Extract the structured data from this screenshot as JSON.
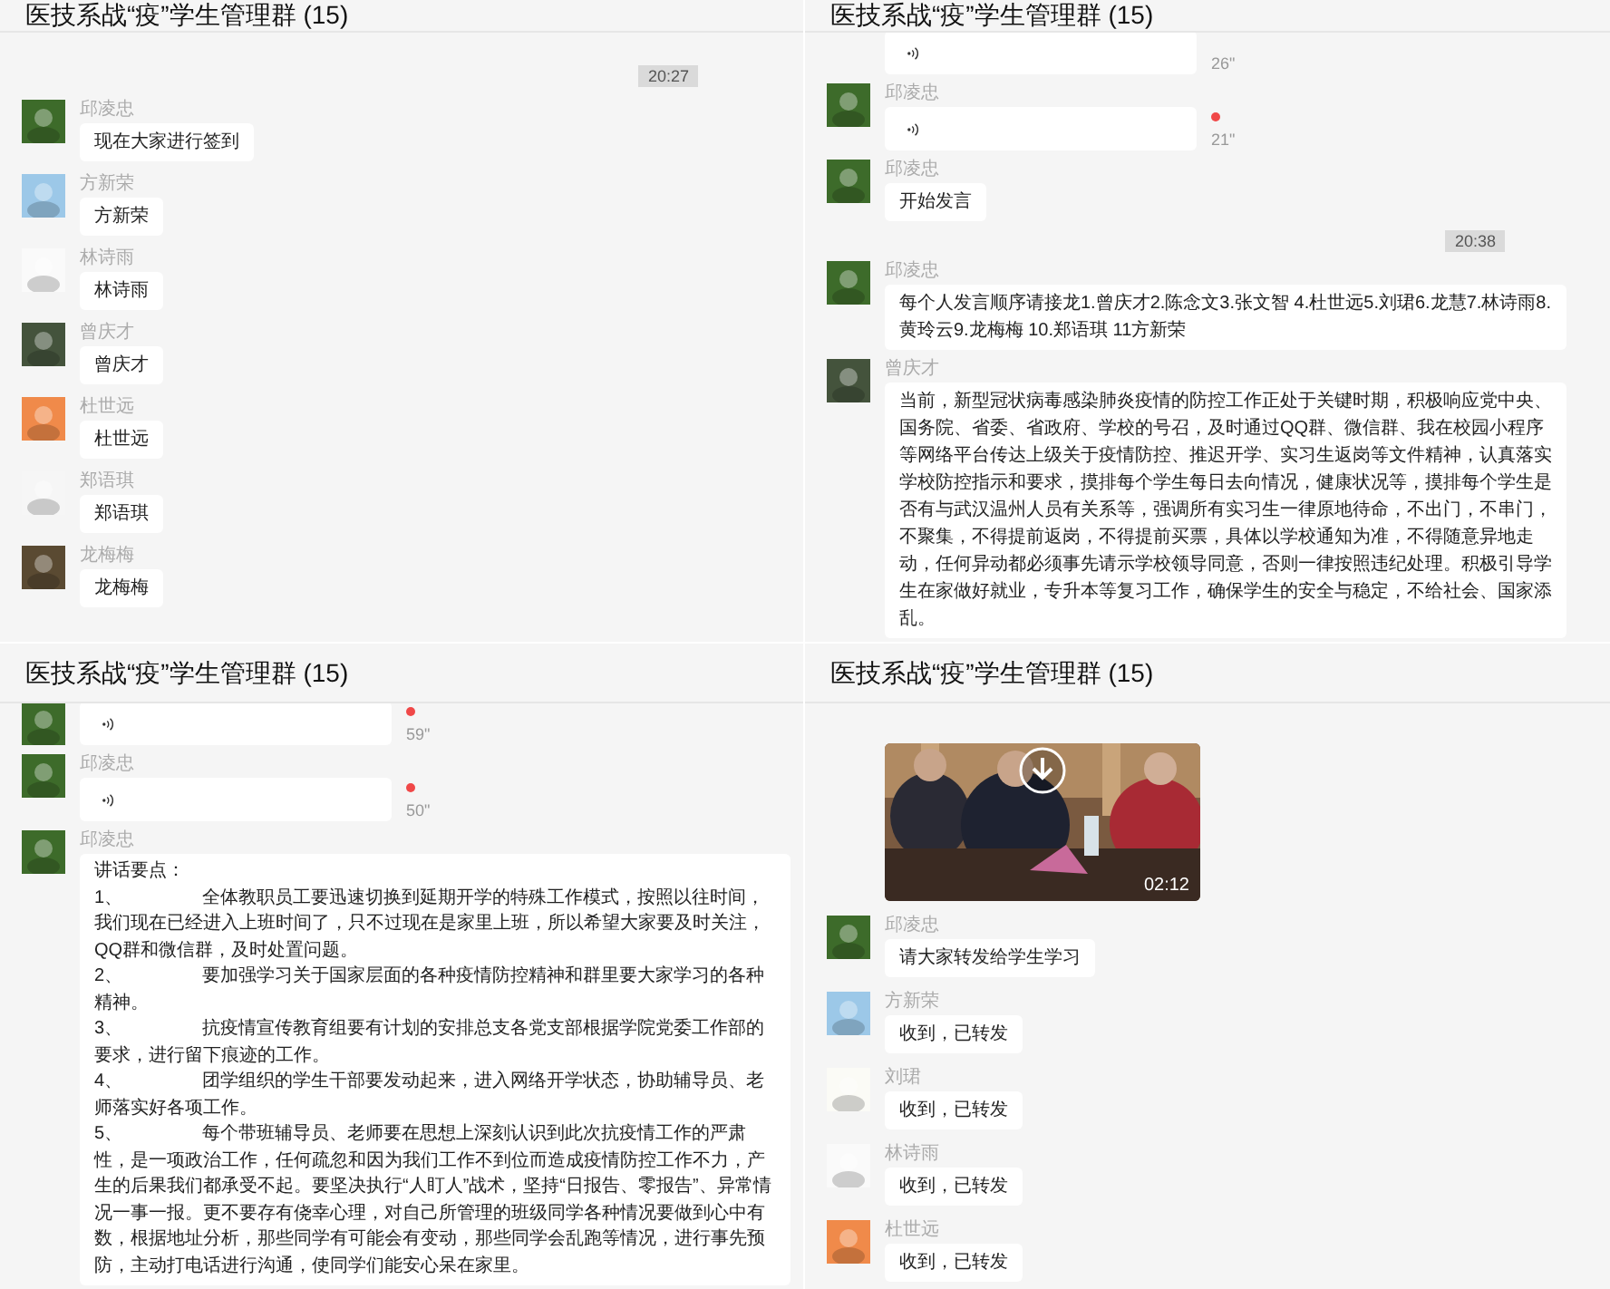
{
  "panels": [
    {
      "title": "医技系战“疫”学生管理群 (15)",
      "messages": [
        {
          "kind": "time",
          "text": "20:27"
        },
        {
          "kind": "text",
          "sender": "邱凌忠",
          "color": "#3d6b2a",
          "text": "现在大家进行签到"
        },
        {
          "kind": "text",
          "sender": "方新荣",
          "color": "#9cc8e8",
          "text": "方新荣"
        },
        {
          "kind": "text",
          "sender": "林诗雨",
          "color": "#fafafa",
          "text": "林诗雨"
        },
        {
          "kind": "text",
          "sender": "曾庆才",
          "color": "#44533c",
          "text": "曾庆才"
        },
        {
          "kind": "text",
          "sender": "杜世远",
          "color": "#f08a4a",
          "text": "杜世远"
        },
        {
          "kind": "text",
          "sender": "郑语琪",
          "color": "#f6f6f6",
          "text": "郑语琪"
        },
        {
          "kind": "text",
          "sender": "龙梅梅",
          "color": "#5a4a32",
          "text": "龙梅梅"
        }
      ]
    },
    {
      "title": "医技系战“疫”学生管理群 (15)",
      "messages": [
        {
          "kind": "voice",
          "duration": "26\""
        },
        {
          "kind": "voice",
          "sender": "邱凌忠",
          "color": "#3d6b2a",
          "duration": "21\"",
          "unread": true
        },
        {
          "kind": "text",
          "sender": "邱凌忠",
          "color": "#3d6b2a",
          "text": "开始发言"
        },
        {
          "kind": "time",
          "text": "20:38"
        },
        {
          "kind": "text",
          "sender": "邱凌忠",
          "color": "#3d6b2a",
          "text": "每个人发言顺序请接龙1.曾庆才2.陈念文3.张文智 4.杜世远5.刘珺6.龙慧7.林诗雨8.黄玲云9.龙梅梅 10.郑语琪 11方新荣"
        },
        {
          "kind": "text",
          "sender": "曾庆才",
          "color": "#44533c",
          "text": "当前，新型冠状病毒感染肺炎疫情的防控工作正处于关键时期，积极响应党中央、国务院、省委、省政府、学校的号召，及时通过QQ群、微信群、我在校园小程序等网络平台传达上级关于疫情防控、推迟开学、实习生返岗等文件精神，认真落实学校防控指示和要求，摸排每个学生每日去向情况，健康状况等，摸排每个学生是否有与武汉温州人员有关系等，强调所有实习生一律原地待命，不出门，不串门，不聚集，不得提前返岗，不得提前买票，具体以学校通知为准，不得随意异地走动，任何异动都必须事先请示学校领导同意，否则一律按照违纪处理。积极引导学生在家做好就业，专升本等复习工作，确保学生的安全与稳定，不给社会、国家添乱。"
        }
      ]
    },
    {
      "title": "医技系战“疫”学生管理群 (15)",
      "messages": [
        {
          "kind": "voice",
          "color": "#3d6b2a",
          "duration": "59\"",
          "unread": true
        },
        {
          "kind": "voice",
          "sender": "邱凌忠",
          "color": "#3d6b2a",
          "duration": "50\"",
          "unread": true
        },
        {
          "kind": "speech",
          "sender": "邱凌忠",
          "color": "#3d6b2a",
          "heading": "讲话要点：",
          "items": [
            {
              "num": "1、",
              "text": "全体教职员工要迅速切换到延期开学的特殊工作模式，按照以往时间，我们现在已经进入上班时间了，只不过现在是家里上班，所以希望大家要及时关注，QQ群和微信群，及时处置问题。"
            },
            {
              "num": "2、",
              "text": "要加强学习关于国家层面的各种疫情防控精神和群里要大家学习的各种精神。"
            },
            {
              "num": "3、",
              "text": "抗疫情宣传教育组要有计划的安排总支各党支部根据学院党委工作部的要求，进行留下痕迹的工作。"
            },
            {
              "num": "4、",
              "text": "团学组织的学生干部要发动起来，进入网络开学状态，协助辅导员、老师落实好各项工作。"
            },
            {
              "num": "5、",
              "text": "每个带班辅导员、老师要在思想上深刻认识到此次抗疫情工作的严肃性，是一项政治工作，任何疏忽和因为我们工作不到位而造成疫情防控工作不力，产生的后果我们都承受不起。要坚决执行“人盯人”战术，坚持“日报告、零报告”、异常情况一事一报。更不要存有侥幸心理，对自己所管理的班级同学各种情况要做到心中有数，根据地址分析，那些同学有可能会有变动，那些同学会乱跑等情况，进行事先预防，主动打电话进行沟通，使同学们能安心呆在家里。"
            }
          ]
        }
      ]
    },
    {
      "title": "医技系战“疫”学生管理群 (15)",
      "messages": [
        {
          "kind": "video",
          "duration": "02:12"
        },
        {
          "kind": "text",
          "sender": "邱凌忠",
          "color": "#3d6b2a",
          "text": "请大家转发给学生学习"
        },
        {
          "kind": "text",
          "sender": "方新荣",
          "color": "#9cc8e8",
          "text": "收到，已转发"
        },
        {
          "kind": "text",
          "sender": "刘珺",
          "color": "#fbfbf6",
          "text": "收到，已转发"
        },
        {
          "kind": "text",
          "sender": "林诗雨",
          "color": "#fafafa",
          "text": "收到，已转发"
        },
        {
          "kind": "text",
          "sender": "杜世远",
          "color": "#f08a4a",
          "text": "收到，已转发"
        }
      ]
    }
  ]
}
